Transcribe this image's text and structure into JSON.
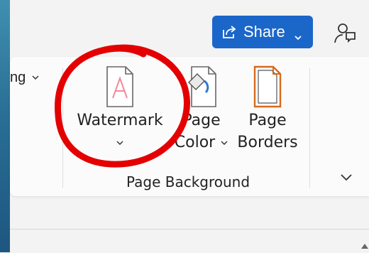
{
  "header": {
    "share_label": "Share",
    "share_icon": "share-icon",
    "comments_icon": "comments-icon"
  },
  "ribbon": {
    "left_partial_label": "ng",
    "commands": {
      "watermark": {
        "label_line1": "Watermark",
        "icon": "watermark-document-icon"
      },
      "page_color": {
        "label_line1": "Page",
        "label_line2": "Color",
        "icon": "page-color-icon"
      },
      "page_borders": {
        "label_line1": "Page",
        "label_line2": "Borders",
        "icon": "page-borders-icon"
      }
    },
    "group_label": "Page Background"
  },
  "colors": {
    "share_bg": "#1b66c9",
    "annotation_red": "#e40000",
    "border_orange": "#d86a1c"
  }
}
